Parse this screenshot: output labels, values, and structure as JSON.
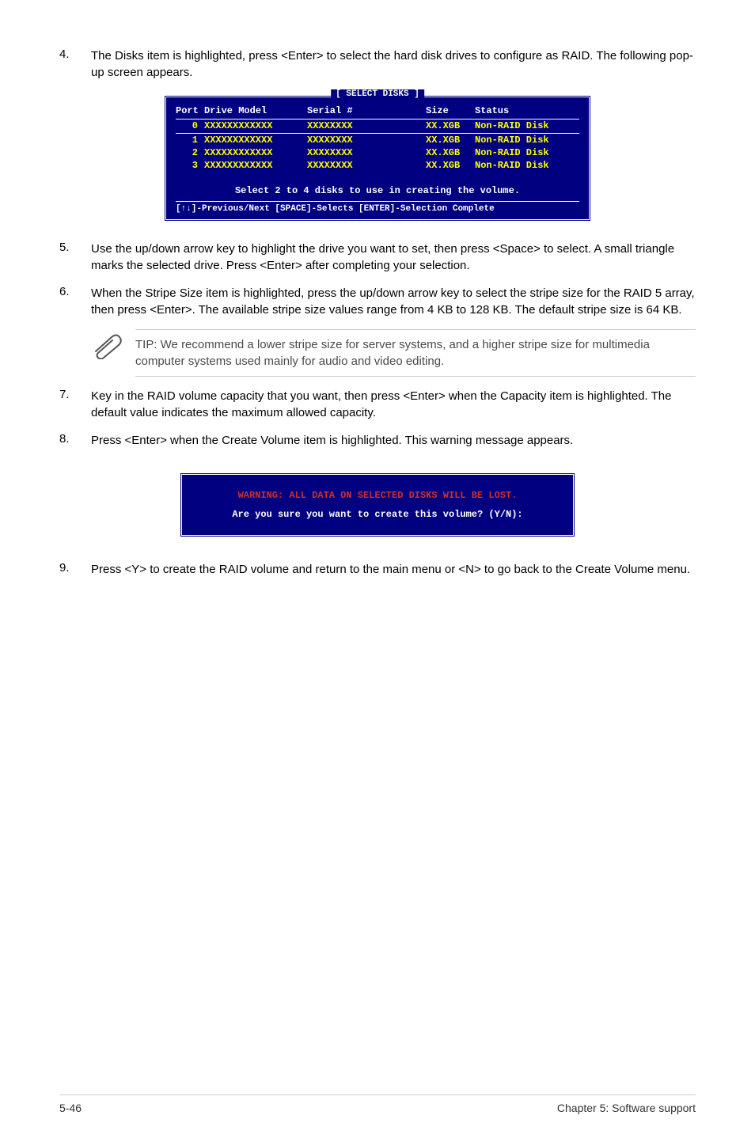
{
  "steps": {
    "s4": {
      "num": "4.",
      "text": "The Disks item is highlighted, press <Enter> to select the hard disk drives to configure as RAID. The following pop-up screen appears."
    },
    "s5": {
      "num": "5.",
      "text": "Use the up/down arrow key to highlight the drive you want to set, then press <Space> to select.  A small triangle marks the selected drive. Press <Enter> after completing your selection."
    },
    "s6": {
      "num": "6.",
      "text": "When the Stripe Size item is highlighted, press the up/down arrow key to select the stripe size for the RAID 5 array, then press <Enter>. The available stripe size values range from 4 KB to 128 KB. The default stripe size is 64 KB."
    },
    "s7": {
      "num": "7.",
      "text": "Key in the RAID volume capacity that you want, then press <Enter> when the Capacity item is highlighted. The default value indicates the maximum allowed capacity."
    },
    "s8": {
      "num": "8.",
      "text": "Press <Enter> when the Create Volume item is highlighted. This warning message appears."
    },
    "s9": {
      "num": "9.",
      "text": "Press <Y> to create the RAID volume and return to the main menu or <N> to go back to the Create Volume menu."
    }
  },
  "tip": "TIP: We recommend a lower stripe size for server systems, and a higher stripe size for multimedia computer systems used mainly for audio and video editing.",
  "bios": {
    "title": "[ SELECT DISKS ]",
    "headers": {
      "port": "Port",
      "model": "Drive Model",
      "serial": "Serial #",
      "size": "Size",
      "status": "Status"
    },
    "rows": [
      {
        "port": "0",
        "model": "XXXXXXXXXXXX",
        "serial": "XXXXXXXX",
        "size": "XX.XGB",
        "status": "Non-RAID Disk"
      },
      {
        "port": "1",
        "model": "XXXXXXXXXXXX",
        "serial": "XXXXXXXX",
        "size": "XX.XGB",
        "status": "Non-RAID Disk"
      },
      {
        "port": "2",
        "model": "XXXXXXXXXXXX",
        "serial": "XXXXXXXX",
        "size": "XX.XGB",
        "status": "Non-RAID Disk"
      },
      {
        "port": "3",
        "model": "XXXXXXXXXXXX",
        "serial": "XXXXXXXX",
        "size": "XX.XGB",
        "status": "Non-RAID Disk"
      }
    ],
    "instruction": "Select 2 to 4 disks to use in creating the volume.",
    "footer": "[↑↓]-Previous/Next  [SPACE]-Selects  [ENTER]-Selection Complete"
  },
  "warning": {
    "line1": "WARNING: ALL DATA ON SELECTED DISKS WILL BE LOST.",
    "line2": "Are you sure you want to create this volume? (Y/N):"
  },
  "footer": {
    "left": "5-46",
    "right": "Chapter 5: Software support"
  }
}
